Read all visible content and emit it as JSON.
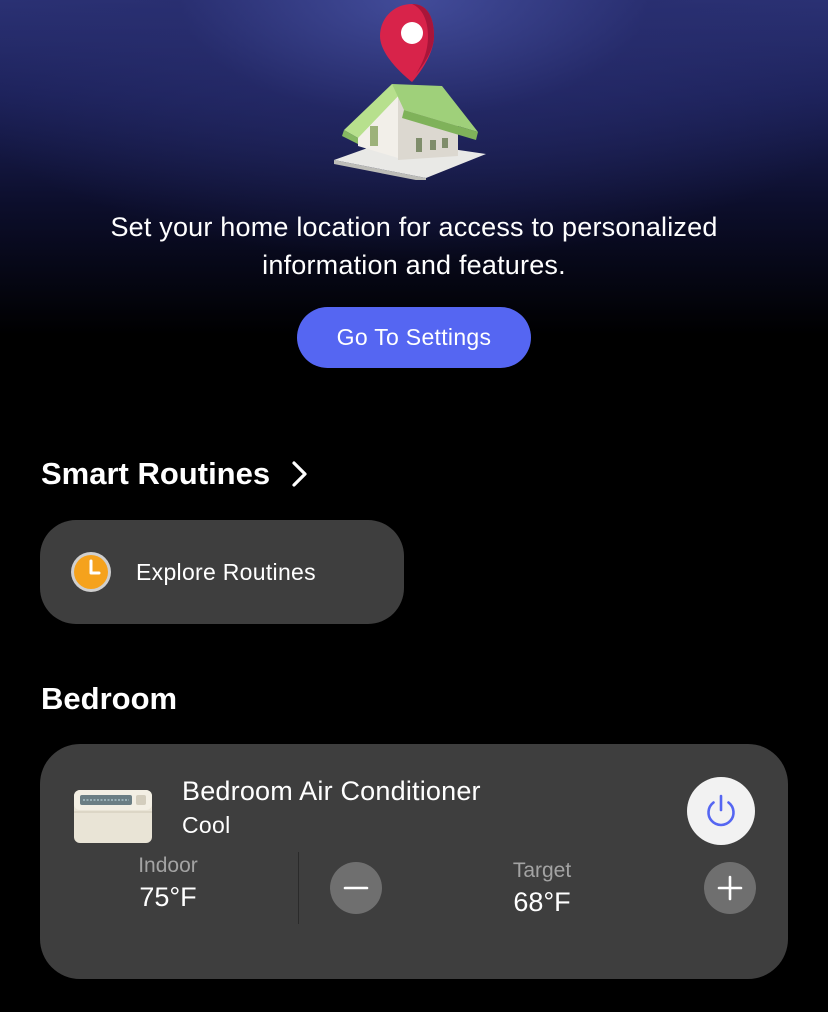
{
  "hero": {
    "line1": "Set your home location for access to personalized",
    "line2": "information and features.",
    "button_label": "Go To Settings"
  },
  "routines": {
    "section_title": "Smart Routines",
    "card_label": "Explore Routines"
  },
  "bedroom": {
    "section_title": "Bedroom",
    "device": {
      "name": "Bedroom Air Conditioner",
      "mode": "Cool",
      "indoor_label": "Indoor",
      "indoor_value": "75°F",
      "target_label": "Target",
      "target_value": "68°F"
    }
  },
  "colors": {
    "accent": "#5566f2",
    "card_bg": "#3e3e3e",
    "clock_orange": "#f5a21c",
    "pin_red": "#d8234a",
    "roof_green": "#9fd07a"
  },
  "icons": [
    "location-pin-icon",
    "house-icon",
    "chevron-right-icon",
    "clock-icon",
    "air-conditioner-icon",
    "power-icon",
    "minus-icon",
    "plus-icon"
  ]
}
